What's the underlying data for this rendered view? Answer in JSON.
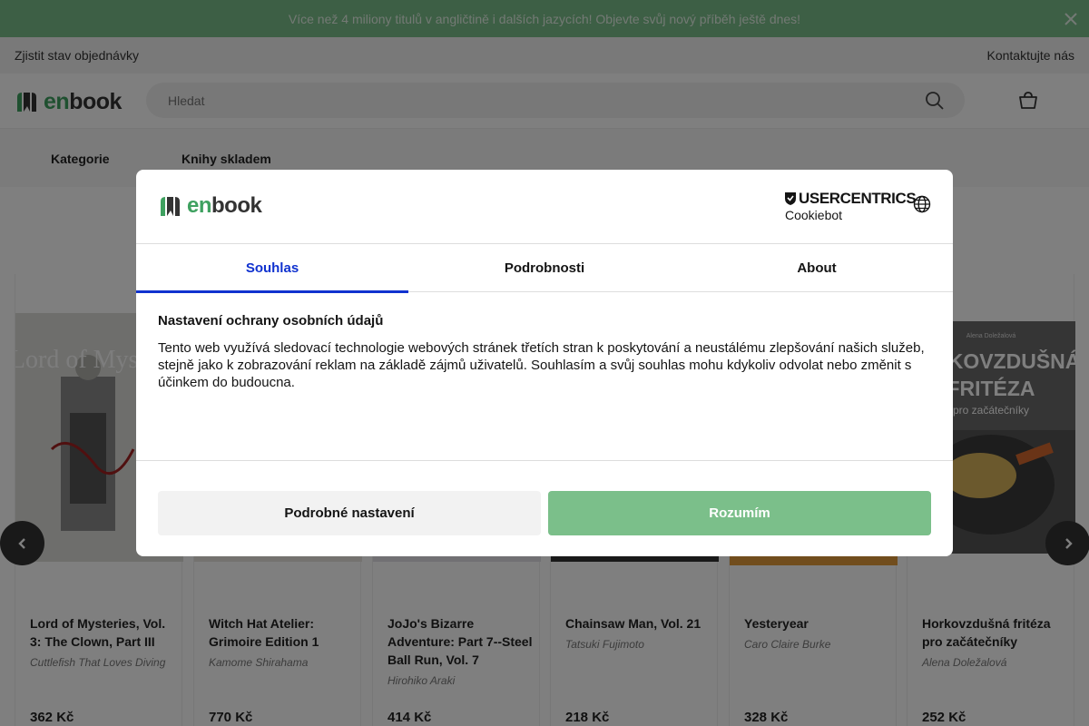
{
  "promo": {
    "text": "Více než 4 miliony titulů v angličtině i dalších jazycích! Objevte svůj nový příběh ještě dnes!"
  },
  "topbar": {
    "order_status": "Zjistit stav objednávky",
    "contact": "Kontaktujte nás"
  },
  "header": {
    "logo_en": "en",
    "logo_book": "book",
    "search_placeholder": "Hledat"
  },
  "nav": {
    "categories": "Kategorie",
    "in_stock": "Knihy skladem"
  },
  "books": [
    {
      "title": "Lord of Mysteries, Vol. 3: The Clown, Part III",
      "author": "Cuttlefish That Loves Diving",
      "price": "362 Kč",
      "cover_title": "Lord of Mysteries"
    },
    {
      "title": "Witch Hat Atelier: Grimoire Edition 1",
      "author": "Kamome Shirahama",
      "price": "770 Kč"
    },
    {
      "title": "JoJo's Bizarre Adventure: Part 7--Steel Ball Run, Vol. 7",
      "author": "Hirohiko Araki",
      "price": "414 Kč"
    },
    {
      "title": "Chainsaw Man, Vol. 21",
      "author": "Tatsuki Fujimoto",
      "price": "218 Kč"
    },
    {
      "title": "Yesteryear",
      "author": "Caro Claire Burke",
      "price": "328 Kč"
    },
    {
      "title": "Horkovzdušná fritéza pro začátečníky",
      "author": "Alena Doležalová",
      "price": "252 Kč",
      "cover_author": "Alena Doležalová",
      "cover_title_1": "HORKOVZDUŠNÁ",
      "cover_title_2": "FRITÉZA",
      "cover_subtitle": "pro začátečníky"
    }
  ],
  "cookie": {
    "logo_en": "en",
    "logo_book": "book",
    "brand_line1": "USERCENTRICS",
    "brand_line2": "Cookiebot",
    "tabs": [
      "Souhlas",
      "Podrobnosti",
      "About"
    ],
    "heading": "Nastavení ochrany osobních údajů",
    "body": "Tento web využívá sledovací technologie webových stránek třetích stran k poskytování a neustálému zlepšování našich služeb, stejně jako k zobrazování reklam na základě zájmů uživatelů. Souhlasím a svůj souhlas mohu kdykoliv odvolat nebo změnit s účinkem do budoucna.",
    "btn_details": "Podrobné nastavení",
    "btn_accept": "Rozumím"
  },
  "colors": {
    "brand_green": "#7bbf8a",
    "active_tab": "#1032cf"
  }
}
